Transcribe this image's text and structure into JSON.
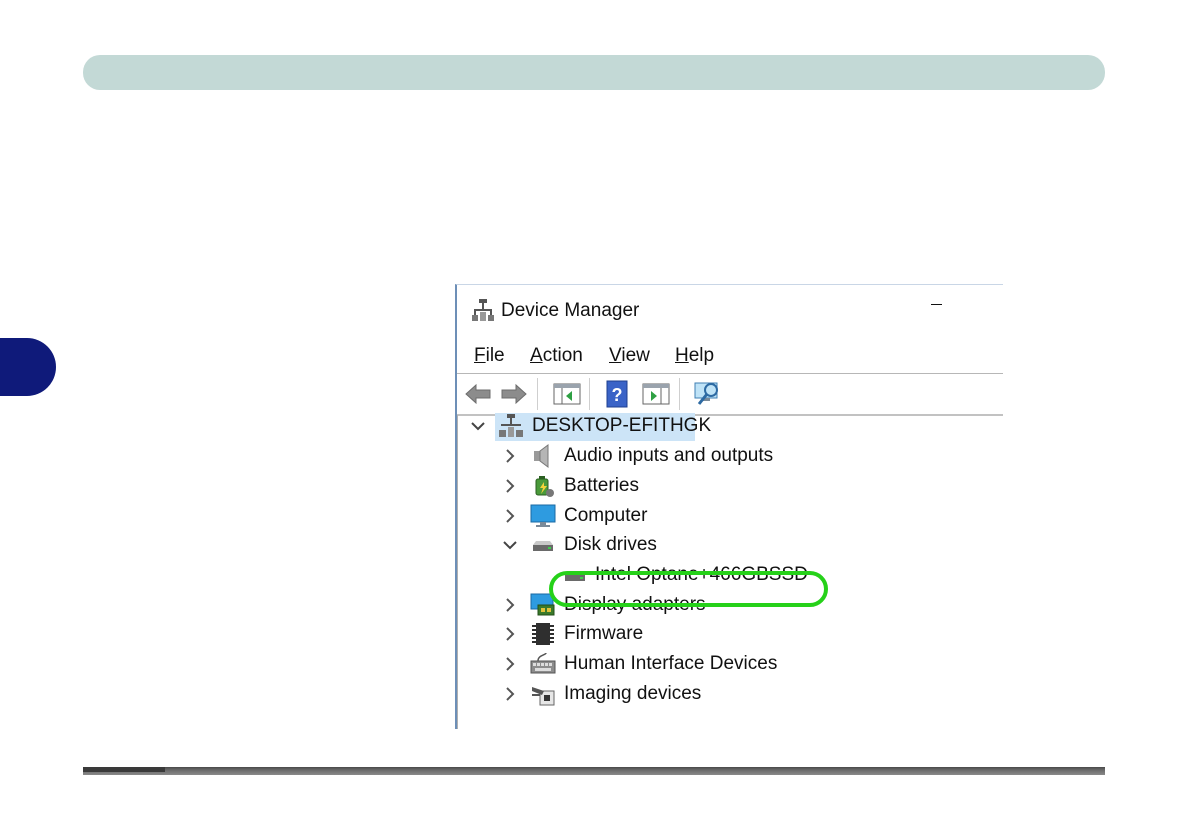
{
  "window": {
    "title": "Device Manager",
    "minimize_glyph": "–"
  },
  "menu": {
    "file": {
      "accel": "F",
      "rest": "ile"
    },
    "action": {
      "accel": "A",
      "rest": "ction"
    },
    "view": {
      "accel": "V",
      "rest": "iew"
    },
    "help": {
      "accel": "H",
      "rest": "elp"
    }
  },
  "toolbar": {
    "buttons": [
      "back-icon",
      "forward-icon",
      "show-hide-console-tree-icon",
      "help-icon",
      "action-pane-icon",
      "scan-hardware-icon"
    ]
  },
  "tree": {
    "root": {
      "label": "DESKTOP-EFITHGK",
      "icon": "computer-tower-icon",
      "expanded": true
    },
    "items": [
      {
        "label": "Audio inputs and outputs",
        "icon": "speaker-icon",
        "expanded": false
      },
      {
        "label": "Batteries",
        "icon": "battery-icon",
        "expanded": false
      },
      {
        "label": "Computer",
        "icon": "monitor-icon",
        "expanded": false
      },
      {
        "label": "Disk drives",
        "icon": "disk-drive-icon",
        "expanded": true
      },
      {
        "label": "Intel Optane+466GBSSD",
        "icon": "disk-drive-icon",
        "child": true,
        "highlighted": true
      },
      {
        "label": "Display adapters",
        "icon": "display-adapter-icon",
        "expanded": false
      },
      {
        "label": "Firmware",
        "icon": "firmware-chip-icon",
        "expanded": false
      },
      {
        "label": "Human Interface Devices",
        "icon": "hid-icon",
        "expanded": false
      },
      {
        "label": "Imaging devices",
        "icon": "camera-icon",
        "expanded": false
      }
    ]
  },
  "colors": {
    "header_bar": "#c3d9d6",
    "side_tab": "#0f1a7a",
    "highlight_ring": "#26d119",
    "selection": "#cce4f7"
  }
}
